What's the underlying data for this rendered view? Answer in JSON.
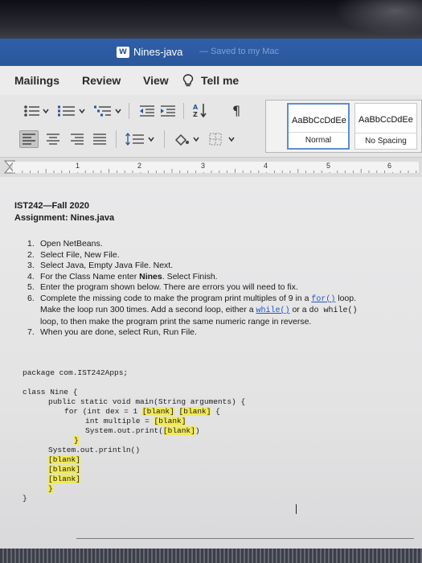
{
  "window": {
    "title": "Nines-java",
    "saved_status": "— Saved to my Mac",
    "app_icon_label": "W"
  },
  "tabs": [
    {
      "label": "Mailings"
    },
    {
      "label": "Review"
    },
    {
      "label": "View"
    },
    {
      "label": "Tell me"
    }
  ],
  "ribbon": {
    "icons": [
      "bullets-icon",
      "numbering-icon",
      "multilevel-list-icon",
      "decrease-indent-icon",
      "increase-indent-icon",
      "sort-icon",
      "pilcrow-icon",
      "align-left-icon",
      "align-center-icon",
      "align-right-icon",
      "justify-icon",
      "line-spacing-icon",
      "shading-icon",
      "borders-icon"
    ],
    "styles": [
      {
        "sample": "AaBbCcDdEe",
        "name": "Normal",
        "selected": true
      },
      {
        "sample": "AaBbCcDdEe",
        "name": "No Spacing",
        "selected": false
      }
    ]
  },
  "ruler": {
    "numbers": [
      "1",
      "2",
      "3",
      "4",
      "5",
      "6"
    ]
  },
  "document": {
    "heading1": "IST242—Fall 2020",
    "heading2": "Assignment: Nines.java",
    "steps": [
      {
        "num": "1.",
        "text": "Open NetBeans."
      },
      {
        "num": "2.",
        "text": "Select File, New File."
      },
      {
        "num": "3.",
        "text": "Select Java, Empty Java File. Next."
      },
      {
        "num": "4.",
        "pre": "For the Class Name enter ",
        "bold": "Nines",
        "post": ". Select Finish."
      },
      {
        "num": "5.",
        "text": "Enter the program shown below. There are errors you will need to fix."
      },
      {
        "num": "6.",
        "line1_pre": "Complete the missing code to make the program print multiples of 9 in a ",
        "line1_code": "for()",
        "line1_post": " loop.",
        "line2_pre": "Make the loop run 300 times. Add a second loop, either a ",
        "line2_code": "while()",
        "line2_mid": " or a ",
        "line2_code2": "do while()",
        "line3": "loop, to then make the program print the same numeric range in reverse."
      },
      {
        "num": "7.",
        "text": "When you are done, select Run, Run File."
      }
    ],
    "code": {
      "package": "package com.IST242Apps;",
      "class_open": "class Nine {",
      "main_sig": "public static void main(String arguments) {",
      "for_pre": "for (int dex = 1 ",
      "for_blank1": "[blank]",
      "for_blank2": "[blank]",
      "for_post": " {",
      "multiple_pre": "int multiple = ",
      "multiple_blank": "[blank]",
      "print_pre": "System.out.print(",
      "print_blank": "[blank]",
      "print_post": ")",
      "inner_close": "}",
      "println": "System.out.println()",
      "blank_a": "[blank]",
      "blank_b": "[blank]",
      "blank_c": "[blank]",
      "close_main": "}",
      "close_class": "}"
    }
  }
}
